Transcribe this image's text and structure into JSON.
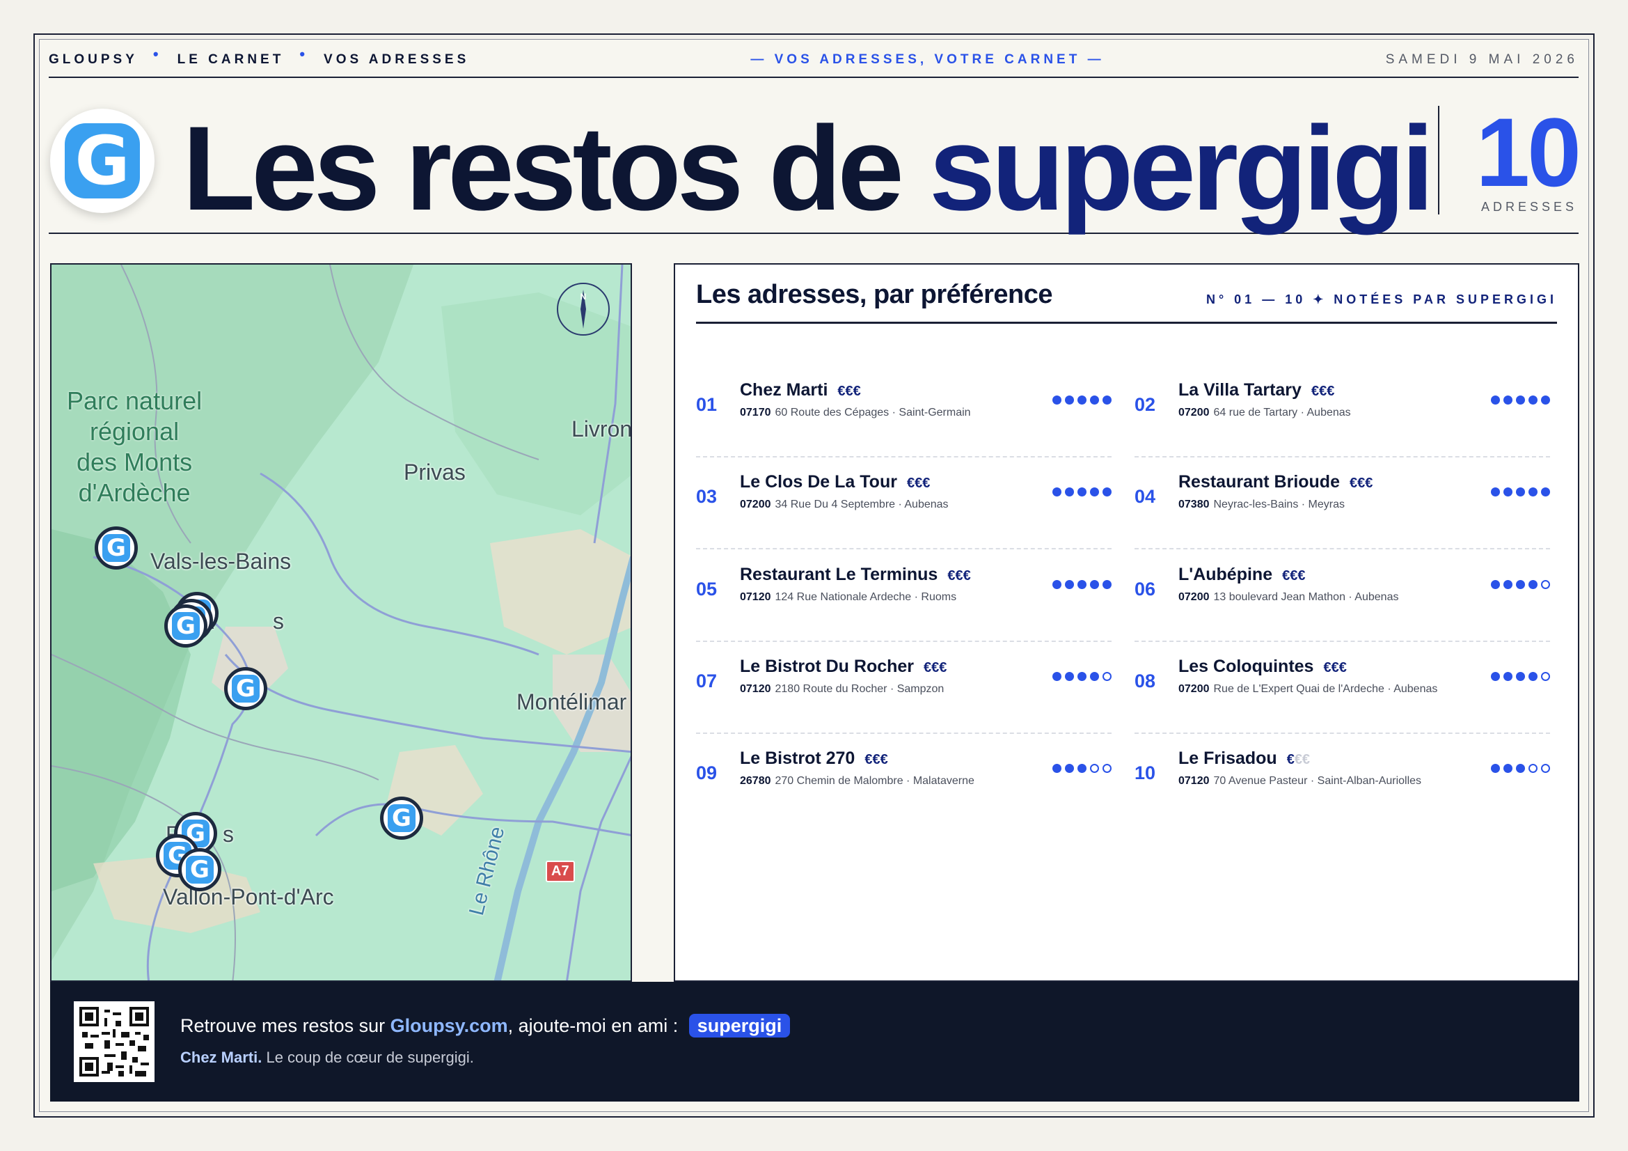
{
  "topbar": {
    "nav": [
      "GLOUPSY",
      "LE CARNET",
      "VOS ADRESSES"
    ],
    "tagline": "— VOS ADRESSES, VOTRE CARNET —",
    "date": "SAMEDI 9 MAI 2026"
  },
  "masthead": {
    "logo_letter": "G",
    "title_main": "Les restos de ",
    "title_accent": "supergigi",
    "count": "10",
    "count_label": "ADRESSES"
  },
  "map": {
    "park_label": [
      "Parc naturel",
      "régional",
      "des Monts",
      "d'Ardèche"
    ],
    "places": {
      "privas": "Privas",
      "livron": "Livron-",
      "vals": "Vals-les-Bains",
      "aubenas_a": "A",
      "aubenas_s": "s",
      "montelimar": "Montélimar",
      "ruoms_r": "R",
      "ruoms_s": "s",
      "vallon": "Vallon-Pont-d'Arc",
      "rhone": "Le Rhône"
    },
    "road_badge": "A7",
    "compass_letter": "N",
    "pin_letter": "G"
  },
  "list": {
    "title": "Les adresses, par préférence",
    "subtitle": "N° 01 — 10  ✦  NOTÉES PAR SUPERGIGI",
    "entries": [
      {
        "num": "01",
        "name": "Chez Marti",
        "price": "€€€",
        "price_dim": "",
        "zip": "07170",
        "addr": "60 Route des Cépages · Saint-Germain",
        "rating": 5
      },
      {
        "num": "02",
        "name": "La Villa Tartary",
        "price": "€€€",
        "price_dim": "",
        "zip": "07200",
        "addr": "64 rue de Tartary · Aubenas",
        "rating": 5
      },
      {
        "num": "03",
        "name": "Le Clos De La Tour",
        "price": "€€€",
        "price_dim": "",
        "zip": "07200",
        "addr": "34 Rue Du 4 Septembre · Aubenas",
        "rating": 5
      },
      {
        "num": "04",
        "name": "Restaurant Brioude",
        "price": "€€€",
        "price_dim": "",
        "zip": "07380",
        "addr": "Neyrac-les-Bains · Meyras",
        "rating": 5
      },
      {
        "num": "05",
        "name": "Restaurant Le Terminus",
        "price": "€€€",
        "price_dim": "",
        "zip": "07120",
        "addr": "124 Rue Nationale Ardeche · Ruoms",
        "rating": 5
      },
      {
        "num": "06",
        "name": "L'Aubépine",
        "price": "€€€",
        "price_dim": "",
        "zip": "07200",
        "addr": "13 boulevard Jean Mathon · Aubenas",
        "rating": 4
      },
      {
        "num": "07",
        "name": "Le Bistrot Du Rocher",
        "price": "€€€",
        "price_dim": "",
        "zip": "07120",
        "addr": "2180 Route du Rocher · Sampzon",
        "rating": 4
      },
      {
        "num": "08",
        "name": "Les Coloquintes",
        "price": "€€€",
        "price_dim": "",
        "zip": "07200",
        "addr": "Rue de L'Expert Quai de l'Ardeche · Aubenas",
        "rating": 4
      },
      {
        "num": "09",
        "name": "Le Bistrot 270",
        "price": "€€€",
        "price_dim": "",
        "zip": "26780",
        "addr": "270 Chemin de Malombre · Malataverne",
        "rating": 3
      },
      {
        "num": "10",
        "name": "Le Frisadou",
        "price": "€",
        "price_dim": "€€",
        "zip": "07120",
        "addr": "70 Avenue Pasteur · Saint-Alban-Auriolles",
        "rating": 3
      }
    ]
  },
  "footer": {
    "line1_prefix": "Retrouve mes restos sur ",
    "site": "Gloupsy.com",
    "line1_suffix": ", ajoute-moi en ami :",
    "username": "supergigi",
    "line2_bold": "Chez Marti.",
    "line2_rest": " Le coup de cœur de supergigi."
  },
  "colors": {
    "accent": "#2a52e8",
    "navy": "#12237a",
    "ink": "#0d1633",
    "footer_bg": "#0f1729"
  }
}
